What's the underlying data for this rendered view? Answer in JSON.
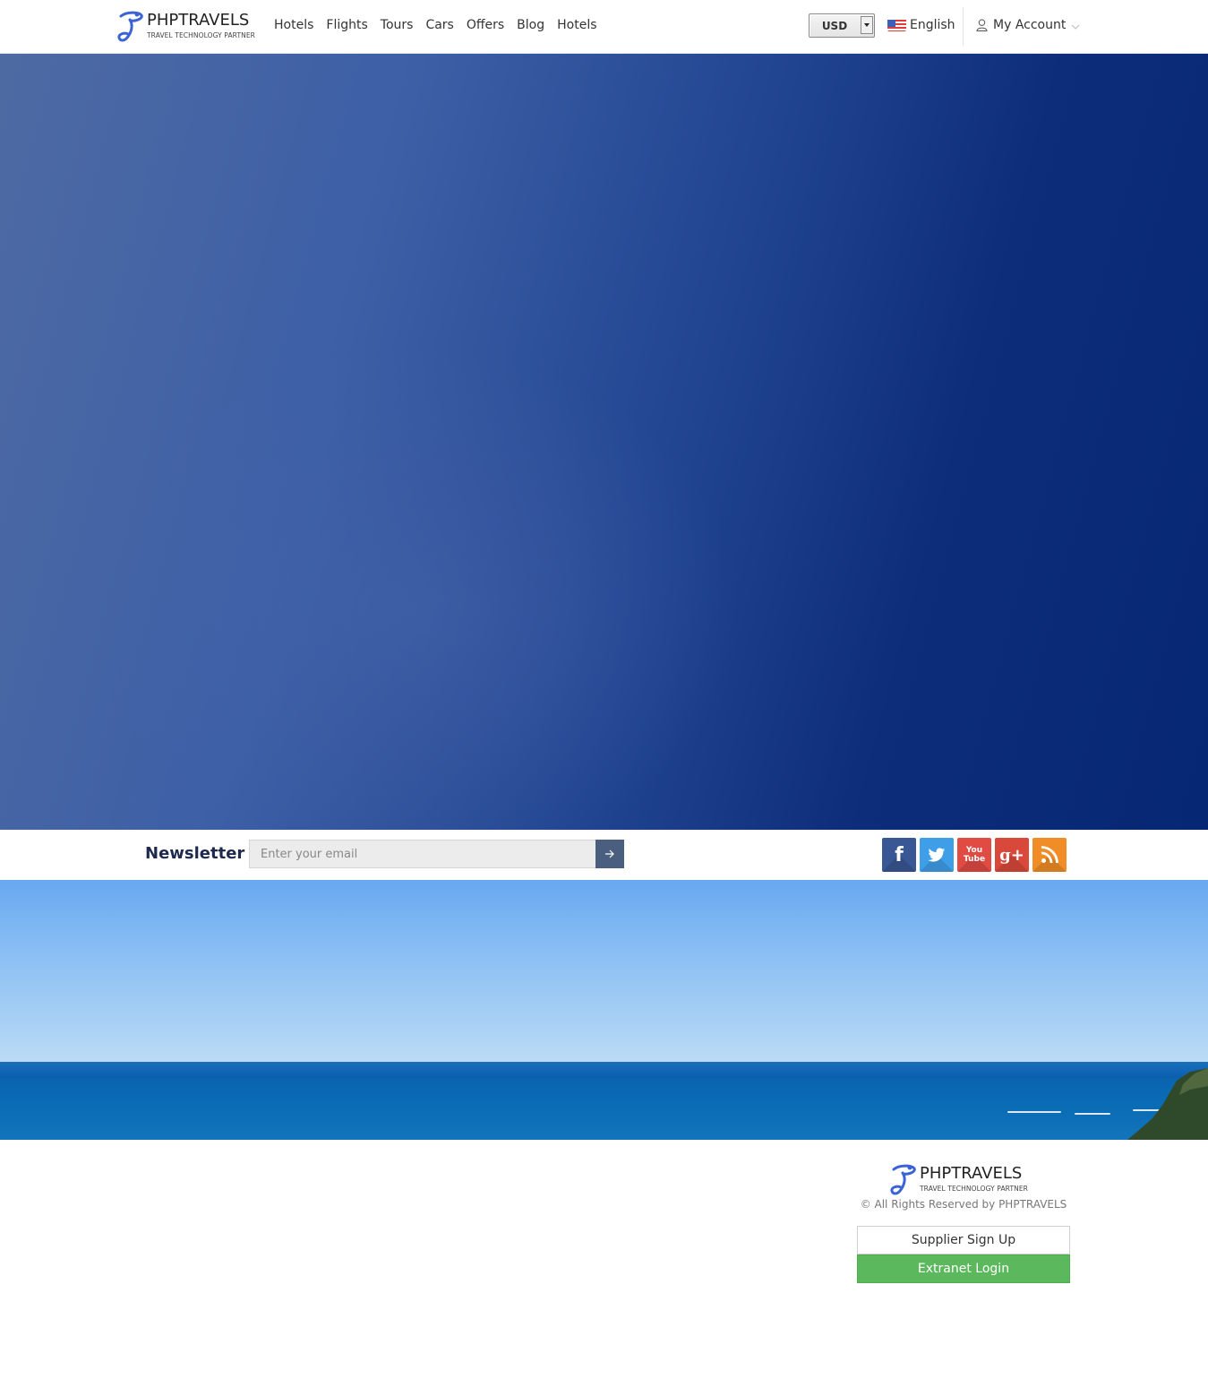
{
  "brand": {
    "name": "PHPTRAVELS",
    "tagline": "TRAVEL TECHNOLOGY PARTNER",
    "color": "#3b63d6"
  },
  "nav": {
    "items": [
      {
        "label": "Hotels"
      },
      {
        "label": "Flights"
      },
      {
        "label": "Tours"
      },
      {
        "label": "Cars"
      },
      {
        "label": "Offers"
      },
      {
        "label": "Blog"
      },
      {
        "label": "Hotels"
      }
    ]
  },
  "header": {
    "currency": "USD",
    "language": "English",
    "language_flag": "us-flag-icon",
    "account": "My Account"
  },
  "newsletter": {
    "title": "Newsletter",
    "placeholder": "Enter your email",
    "submit_icon": "arrow-right-icon"
  },
  "social": [
    {
      "name": "facebook",
      "label": "f",
      "color": "#3a5795"
    },
    {
      "name": "twitter",
      "color": "#3f9ee8"
    },
    {
      "name": "youtube",
      "label_top": "You",
      "label_bottom": "Tube",
      "color": "#e04b44"
    },
    {
      "name": "google-plus",
      "label": "g+",
      "color": "#d9493b"
    },
    {
      "name": "rss",
      "color": "#f08d26"
    }
  ],
  "footer": {
    "copyright": "© All Rights Reserved by PHPTRAVELS",
    "supplier_signup": "Supplier Sign Up",
    "extranet_login": "Extranet Login",
    "extranet_color": "#5cb85c"
  }
}
